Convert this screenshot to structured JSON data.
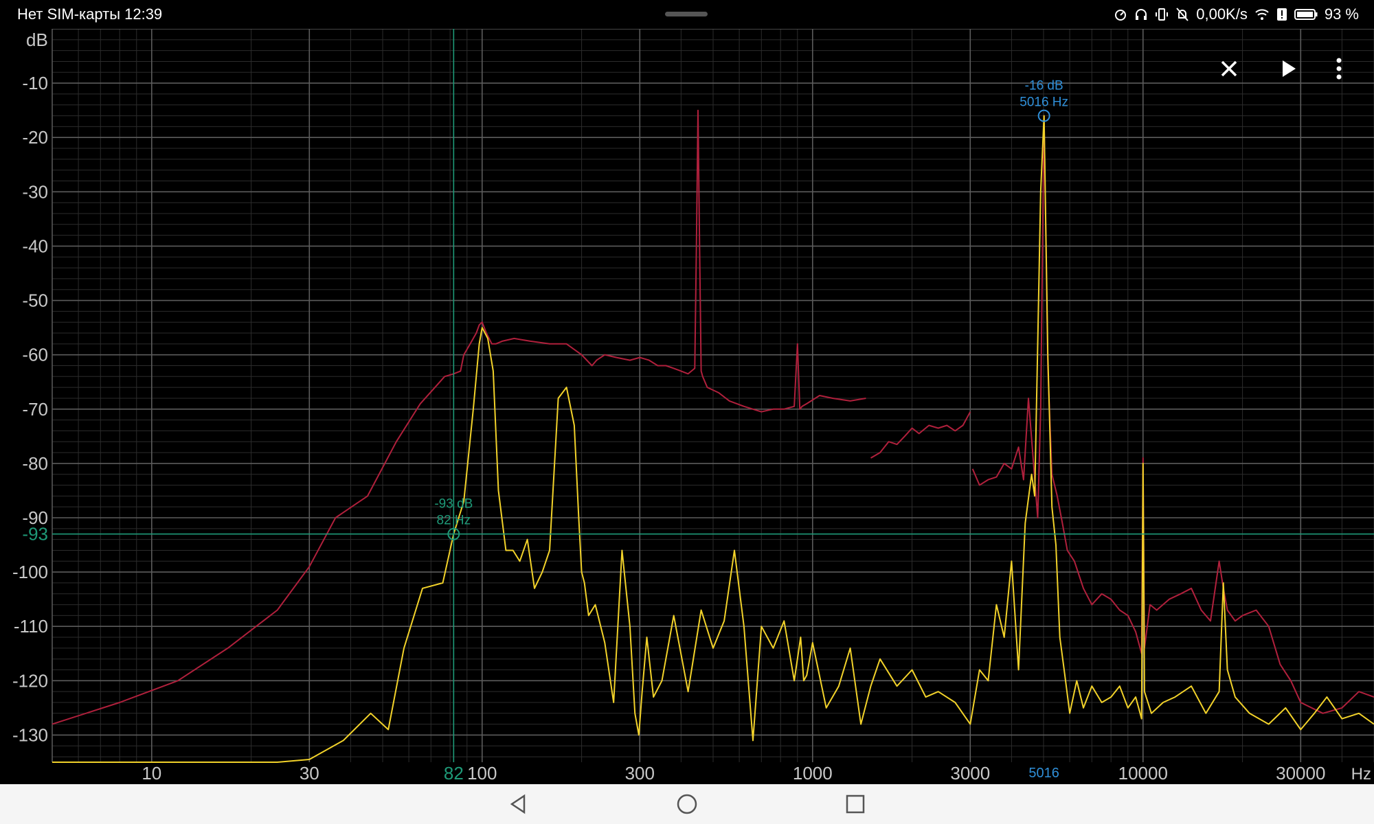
{
  "status_bar": {
    "carrier_time": "Нет SIM-карты 12:39",
    "net_speed": "0,00K/s",
    "battery": "93 %",
    "icons": [
      "speedometer-icon",
      "headphones-icon",
      "vibrate-icon",
      "mute-icon",
      "wifi-icon",
      "alert-icon",
      "battery-icon"
    ]
  },
  "toolbar": {
    "icons": [
      "close-icon",
      "play-icon",
      "more-vert-icon"
    ]
  },
  "nav_bar": {
    "icons": [
      "back-icon",
      "home-icon",
      "recents-icon"
    ]
  },
  "colors": {
    "background": "#000000",
    "grid_major": "#5c5c5c",
    "grid_minor": "#2c2c2c",
    "axis_text": "#c8c8c8",
    "series_red": "#b0203c",
    "series_yellow": "#f2d22a",
    "cursor_green": "#1e9a78",
    "peak_blue": "#2f8fd8"
  },
  "chart_data": {
    "type": "line",
    "x_scale": "log",
    "xlim": [
      5,
      50000
    ],
    "ylim": [
      -135,
      0
    ],
    "xlabel": "Hz",
    "ylabel": "dB",
    "x_ticks": [
      10,
      30,
      100,
      300,
      1000,
      3000,
      10000,
      30000
    ],
    "x_tick_labels": [
      "10",
      "30",
      "100",
      "300",
      "1000",
      "3000",
      "10000",
      "30000"
    ],
    "y_ticks": [
      -10,
      -20,
      -30,
      -40,
      -50,
      -60,
      -70,
      -80,
      -90,
      -100,
      -110,
      -120,
      -130
    ],
    "y_tick_labels": [
      "-10",
      "-20",
      "-30",
      "-40",
      "-50",
      "-60",
      "-70",
      "-80",
      "-90",
      "-100",
      "-110",
      "-120",
      "-130"
    ],
    "grid": true,
    "series": [
      {
        "color": "#b0203c",
        "x": [
          5,
          8,
          12,
          17,
          24,
          30,
          36,
          45,
          55,
          65,
          72,
          77,
          82,
          86,
          88,
          92,
          96,
          98,
          100,
          103,
          107,
          110,
          115,
          125,
          140,
          160,
          180,
          200,
          215,
          222,
          235,
          255,
          280,
          300,
          320,
          340,
          360,
          380,
          400,
          420,
          440,
          445,
          450,
          455,
          460,
          465,
          480,
          520,
          560,
          620,
          700,
          760,
          820,
          880,
          900,
          915,
          930,
          960,
          1050,
          1150,
          1300,
          1450
        ],
        "y": [
          -128,
          -124,
          -120,
          -114,
          -107,
          -99,
          -90,
          -86,
          -76,
          -69,
          -66,
          -64,
          -63.5,
          -63,
          -60,
          -58,
          -56,
          -54.5,
          -54,
          -56,
          -58,
          -58,
          -57.5,
          -57,
          -57.5,
          -58,
          -58,
          -60,
          -62,
          -61,
          -60,
          -60.5,
          -61,
          -60.5,
          -61,
          -62,
          -62,
          -62.5,
          -63,
          -63.5,
          -62.5,
          -40,
          -15,
          -40,
          -63,
          -64,
          -66,
          -67,
          -68.5,
          -69.5,
          -70.5,
          -70,
          -70,
          -69.5,
          -58,
          -70,
          -69.5,
          -69,
          -67.5,
          -68,
          -68.5,
          -68
        ]
      },
      {
        "color": "#b0203c",
        "x": [
          1500,
          1600,
          1700,
          1800,
          1900,
          2000,
          2100,
          2250,
          2400,
          2550,
          2700,
          2850,
          3000
        ],
        "y": [
          -79,
          -78,
          -76,
          -76.5,
          -75,
          -73.5,
          -74.5,
          -73,
          -73.5,
          -73,
          -74,
          -73,
          -70.5
        ]
      },
      {
        "color": "#b0203c",
        "x": [
          3050,
          3200,
          3400,
          3600,
          3800,
          4000,
          4200,
          4350,
          4500,
          4650,
          4800,
          4900,
          5016,
          5150,
          5300,
          5500,
          5700,
          5900,
          6200,
          6600,
          7000,
          7500,
          8000,
          8500,
          9000,
          9500,
          9900,
          10000,
          10100,
          10500,
          11000,
          12000,
          13000,
          14000,
          15000,
          16000,
          17000,
          17500,
          18000,
          19000,
          20000,
          22000,
          24000,
          26000,
          28000,
          30000,
          35000,
          40000,
          45000,
          50000
        ],
        "y": [
          -81,
          -84,
          -83,
          -82.5,
          -80,
          -81,
          -77,
          -83,
          -68,
          -79,
          -90,
          -70,
          -16,
          -62,
          -82,
          -86,
          -91,
          -96,
          -98,
          -103,
          -106,
          -104,
          -105,
          -107,
          -108,
          -111,
          -115,
          -79,
          -114,
          -106,
          -107,
          -105,
          -104,
          -103,
          -107,
          -109,
          -98,
          -103,
          -107,
          -109,
          -108,
          -107,
          -110,
          -117,
          -120,
          -124,
          -126,
          -125,
          -122,
          -123
        ]
      },
      {
        "color": "#f2d22a",
        "x": [
          5,
          15,
          24,
          30,
          38,
          46,
          52,
          58,
          66,
          76,
          82,
          88,
          94,
          98,
          100,
          104,
          108,
          112,
          118,
          124,
          130,
          137,
          144,
          152,
          160,
          170,
          180,
          190,
          196,
          200,
          204,
          210,
          220,
          235,
          250,
          265,
          280,
          290,
          298,
          305,
          315,
          330,
          350,
          380,
          420,
          460,
          500,
          540,
          580,
          620,
          660,
          700,
          760,
          820,
          880,
          920,
          940,
          960,
          1000,
          1100,
          1200,
          1300,
          1400,
          1500,
          1600,
          1800,
          2000,
          2200,
          2400,
          2700,
          3000,
          3200,
          3400,
          3600,
          3800,
          4000,
          4200,
          4400,
          4600,
          4700,
          4800,
          4900,
          5016,
          5150,
          5300,
          5450,
          5600,
          5800,
          6000,
          6300,
          6600,
          7000,
          7500,
          8000,
          8500,
          9000,
          9500,
          9900,
          10000,
          10100,
          10600,
          11500,
          12500,
          14000,
          15500,
          17000,
          17500,
          18000,
          19000,
          21000,
          24000,
          27000,
          30000,
          33000,
          36000,
          40000,
          45000,
          50000
        ],
        "y": [
          -135,
          -135,
          -135,
          -134.5,
          -131,
          -126,
          -129,
          -114,
          -103,
          -102,
          -93,
          -87,
          -70,
          -58,
          -55,
          -57,
          -63,
          -85,
          -96,
          -96,
          -98,
          -94,
          -103,
          -100,
          -96,
          -68,
          -66,
          -73,
          -90,
          -100,
          -102,
          -108,
          -106,
          -113,
          -124,
          -96,
          -110,
          -126,
          -130,
          -122,
          -112,
          -123,
          -120,
          -108,
          -122,
          -107,
          -114,
          -109,
          -96,
          -110,
          -131,
          -110,
          -114,
          -109,
          -120,
          -112,
          -120,
          -119,
          -113,
          -125,
          -121,
          -114,
          -128,
          -121,
          -116,
          -121,
          -118,
          -123,
          -122,
          -124,
          -128,
          -118,
          -120,
          -106,
          -112,
          -98,
          -118,
          -91,
          -82,
          -86,
          -58,
          -30,
          -16,
          -60,
          -88,
          -95,
          -112,
          -119,
          -126,
          -120,
          -125,
          -121,
          -124,
          -123,
          -121,
          -125,
          -123,
          -127,
          -80,
          -122,
          -126,
          -124,
          -123,
          -121,
          -126,
          -122,
          -102,
          -118,
          -123,
          -126,
          -128,
          -125,
          -129,
          -126,
          -123,
          -127,
          -126,
          -128
        ]
      }
    ],
    "markers": [
      {
        "label": "-93 dB",
        "freq_label": "82 Hz",
        "x": 82,
        "y": -93,
        "color": "#1e9a78"
      },
      {
        "label": "-16 dB",
        "freq_label": "5016 Hz",
        "x": 5016,
        "y": -16,
        "color": "#2f8fd8"
      }
    ],
    "cursor": {
      "x": 82,
      "y": -93,
      "x_label": "82",
      "y_label": "-93",
      "color": "#1e9a78"
    },
    "peak_x_label": "5016"
  }
}
